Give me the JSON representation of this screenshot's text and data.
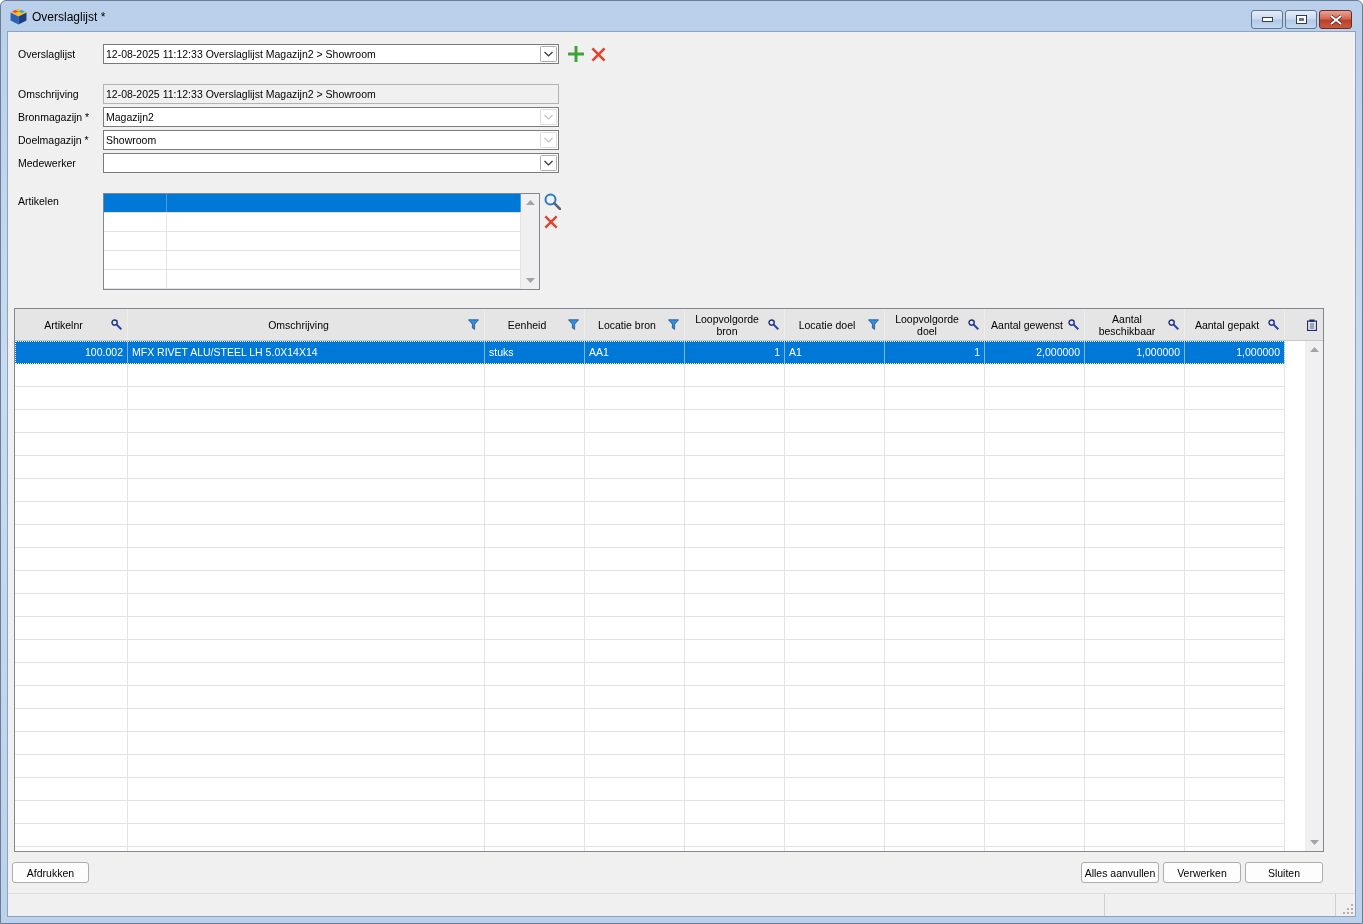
{
  "window": {
    "title": "Overslaglijst *"
  },
  "selector": {
    "label": "Overslaglijst",
    "kind": "combo",
    "value": "12-08-2025 11:12:33 Overslaglijst Magazijn2 > Showroom",
    "disabled": false
  },
  "fields": [
    {
      "label": "Omschrijving",
      "kind": "text",
      "value": "12-08-2025 11:12:33 Overslaglijst Magazijn2 > Showroom",
      "disabled": true
    },
    {
      "label": "Bronmagazijn *",
      "kind": "combo",
      "value": "Magazijn2",
      "disabled": true
    },
    {
      "label": "Doelmagazijn *",
      "kind": "combo",
      "value": "Showroom",
      "disabled": true
    },
    {
      "label": "Medewerker",
      "kind": "combo",
      "disabled": false
    }
  ],
  "artikelen": {
    "label": "Artikelen",
    "rows": [
      {
        "selected": true
      },
      {
        "selected": false
      },
      {
        "selected": false
      },
      {
        "selected": false
      },
      {
        "selected": false
      }
    ]
  },
  "table": {
    "columns": [
      {
        "label": "Artikelnr",
        "kind": "number"
      },
      {
        "label": "Omschrijving",
        "kind": "text"
      },
      {
        "label": "Eenheid",
        "kind": "text"
      },
      {
        "label": "Locatie bron",
        "kind": "text"
      },
      {
        "label": "Loopvolgorde bron",
        "kind": "number"
      },
      {
        "label": "Locatie doel",
        "kind": "text"
      },
      {
        "label": "Loopvolgorde doel",
        "kind": "number"
      },
      {
        "label": "Aantal gewenst",
        "kind": "number"
      },
      {
        "label": "Aantal beschikbaar",
        "kind": "number"
      },
      {
        "label": "Aantal gepakt",
        "kind": "number"
      }
    ],
    "rows": [
      {
        "selected": true,
        "cells": [
          "100.002",
          "MFX RIVET ALU/STEEL LH 5.0X14X14",
          "stuks",
          "AA1",
          "1",
          "A1",
          "1",
          "2,000000",
          "1,000000",
          "1,000000"
        ]
      }
    ]
  },
  "buttons": {
    "left": [
      "Afdrukken"
    ],
    "right": [
      "Alles aanvullen",
      "Verwerken",
      "Sluiten"
    ]
  }
}
